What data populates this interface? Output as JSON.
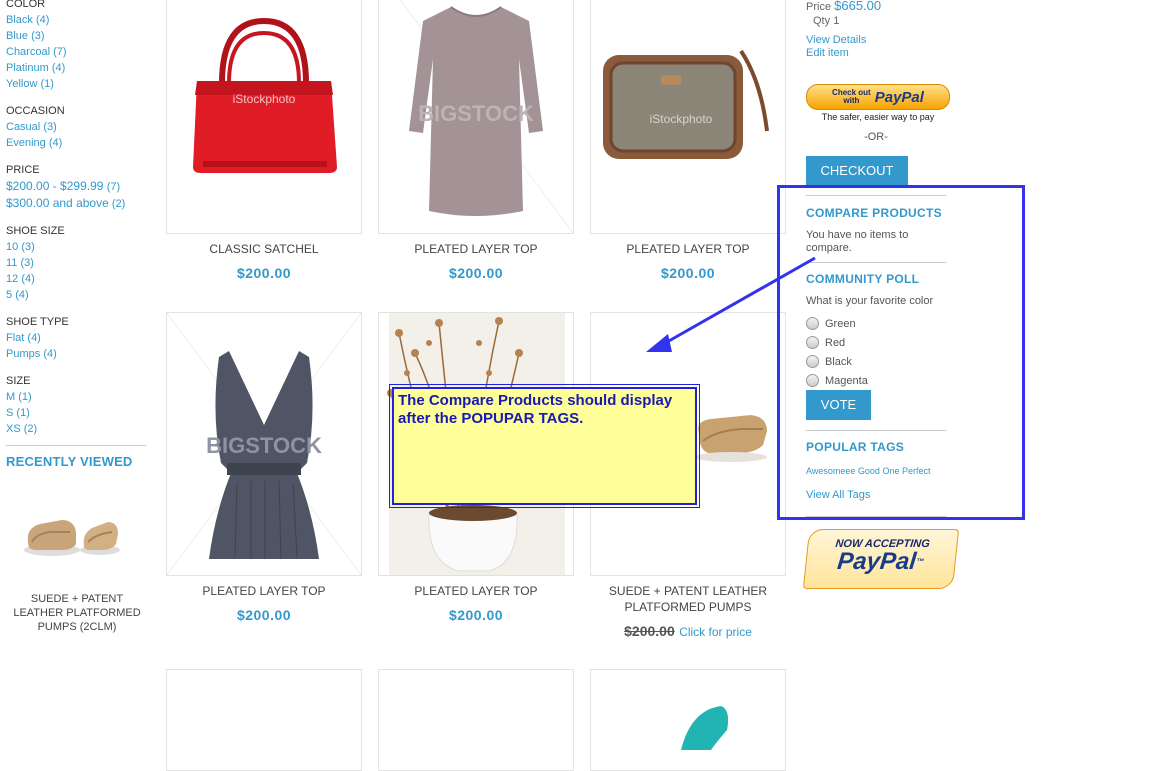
{
  "filters": [
    {
      "heading": "COLOR",
      "items": [
        {
          "label": "Black",
          "count": "(4)"
        },
        {
          "label": "Blue",
          "count": "(3)"
        },
        {
          "label": "Charcoal",
          "count": "(7)"
        },
        {
          "label": "Platinum",
          "count": "(4)"
        },
        {
          "label": "Yellow",
          "count": "(1)"
        }
      ]
    },
    {
      "heading": "OCCASION",
      "items": [
        {
          "label": "Casual",
          "count": "(3)"
        },
        {
          "label": "Evening",
          "count": "(4)"
        }
      ]
    },
    {
      "heading": "PRICE",
      "items": [
        {
          "label": "$200.00 - $299.99",
          "count": "(7)"
        },
        {
          "label": "$300.00 and above",
          "count": "(2)"
        }
      ]
    },
    {
      "heading": "SHOE SIZE",
      "items": [
        {
          "label": "10",
          "count": "(3)"
        },
        {
          "label": "11",
          "count": "(3)"
        },
        {
          "label": "12",
          "count": "(4)"
        },
        {
          "label": "5",
          "count": "(4)"
        }
      ]
    },
    {
      "heading": "SHOE TYPE",
      "items": [
        {
          "label": "Flat",
          "count": "(4)"
        },
        {
          "label": "Pumps",
          "count": "(4)"
        }
      ]
    },
    {
      "heading": "SIZE",
      "items": [
        {
          "label": "M",
          "count": "(1)"
        },
        {
          "label": "S",
          "count": "(1)"
        },
        {
          "label": "XS",
          "count": "(2)"
        }
      ]
    }
  ],
  "recently_viewed": {
    "title": "RECENTLY VIEWED",
    "name_lines": [
      "SUEDE + PATENT",
      "LEATHER PLATFORMED",
      "PUMPS (2CLM)"
    ]
  },
  "products": [
    {
      "name": "CLASSIC SATCHEL",
      "price": "$200.00",
      "image": "red-handbag",
      "watermark": "iStockphoto"
    },
    {
      "name": "PLEATED LAYER TOP",
      "price": "$200.00",
      "image": "mauve-long-sleeve-top",
      "watermark": "BIGSTOCK"
    },
    {
      "name": "PLEATED LAYER TOP",
      "price": "$200.00",
      "image": "tweed-shoulder-bag",
      "watermark": "iStockphoto"
    },
    {
      "name": "PLEATED LAYER TOP",
      "price": "$200.00",
      "image": "gray-pleated-top",
      "watermark": "BIGSTOCK"
    },
    {
      "name": "PLEATED LAYER TOP",
      "price": "$200.00",
      "image": "dried-flowers-vase"
    },
    {
      "name_lines": [
        "SUEDE + PATENT LEATHER",
        "PLATFORMED PUMPS"
      ],
      "old_price": "$200.00",
      "price_link": "Click for price",
      "image": "tan-loafers"
    }
  ],
  "cart": {
    "price_label": "Price",
    "price": "$665.00",
    "qty_label": "Qty",
    "qty": "1",
    "view_details": "View Details",
    "edit_item": "Edit item",
    "paypal_top": "Check out",
    "paypal_with": "with",
    "paypal_brand": "PayPal",
    "paypal_tagline": "The safer, easier way to pay",
    "or_text": "-OR-",
    "checkout_label": "CHECKOUT"
  },
  "compare": {
    "title": "COMPARE PRODUCTS",
    "message": "You have no items to compare."
  },
  "poll": {
    "title": "COMMUNITY POLL",
    "question": "What is your favorite color",
    "options": [
      "Green",
      "Red",
      "Black",
      "Magenta"
    ],
    "vote_label": "VOTE"
  },
  "tags": {
    "title": "POPULAR TAGS",
    "items": [
      "Awesomeee",
      "Good",
      "One",
      "Perfect"
    ],
    "view_all": "View All Tags"
  },
  "paypal_badge": {
    "line1": "NOW ACCEPTING",
    "brand": "PayPal",
    "tm": "™"
  },
  "annotation": {
    "text": "The Compare Products should display after the POPUPAR TAGS."
  },
  "colors": {
    "accent": "#3399cc",
    "annotation_border": "#2222dd",
    "annotation_fill": "#ffff99"
  }
}
